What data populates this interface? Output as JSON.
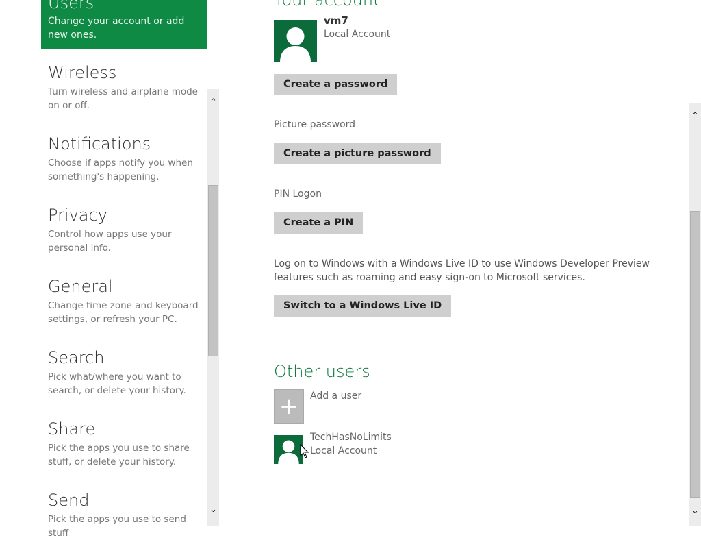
{
  "nav": {
    "selected": {
      "title": "Users",
      "desc": "Change your account or add new ones."
    },
    "items": [
      {
        "title": "Wireless",
        "desc": "Turn wireless and airplane mode on or off."
      },
      {
        "title": "Notifications",
        "desc": "Choose if apps notify you when something's happening."
      },
      {
        "title": "Privacy",
        "desc": "Control how apps use your personal info."
      },
      {
        "title": "General",
        "desc": "Change time zone and keyboard settings, or refresh your PC."
      },
      {
        "title": "Search",
        "desc": "Pick what/where you want to search, or delete your history."
      },
      {
        "title": "Share",
        "desc": "Pick the apps you use to share stuff, or delete your history."
      },
      {
        "title": "Send",
        "desc": "Pick the apps you use to send stuff"
      }
    ],
    "scroll_up": "⌃",
    "scroll_down": "⌄"
  },
  "account": {
    "heading": "Your account",
    "user_name": "vm7",
    "user_type": "Local Account",
    "create_password_btn": "Create a password",
    "picture_password_label": "Picture password",
    "create_picture_password_btn": "Create a picture password",
    "pin_label": "PIN Logon",
    "create_pin_btn": "Create a PIN",
    "live_id_text": "Log on to Windows with a Windows Live ID to use Windows Developer Preview features such as roaming and easy sign-on to Microsoft services.",
    "switch_live_id_btn": "Switch to a Windows Live ID"
  },
  "other_users": {
    "heading": "Other users",
    "add_user_label": "Add a user",
    "add_icon": "+",
    "users": [
      {
        "name": "TechHasNoLimits",
        "type": "Local Account"
      }
    ]
  },
  "colors": {
    "accent": "#0f8a45",
    "avatar": "#0b6b3a"
  }
}
